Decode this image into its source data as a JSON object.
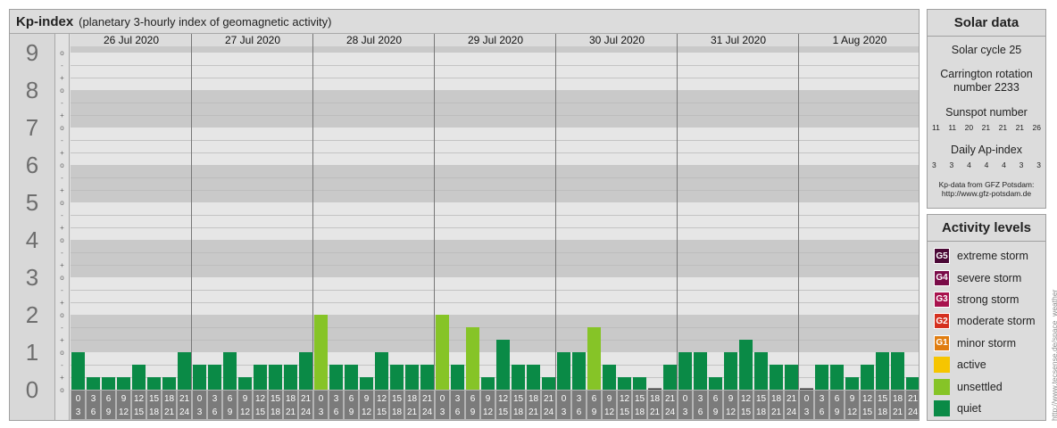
{
  "header": {
    "title": "Kp-index",
    "subtitle": "(planetary 3-hourly index of geomagnetic activity)"
  },
  "chart_data": {
    "type": "bar",
    "title": "Kp-index",
    "subtitle": "(planetary 3-hourly index of geomagnetic activity)",
    "y_axis_labels": [
      "0",
      "1",
      "2",
      "3",
      "4",
      "5",
      "6",
      "7",
      "8",
      "9"
    ],
    "sub_ticks": [
      "o",
      "+",
      "-"
    ],
    "ylim": [
      0,
      9.333
    ],
    "days": [
      "26 Jul 2020",
      "27 Jul 2020",
      "28 Jul 2020",
      "29 Jul 2020",
      "30 Jul 2020",
      "31 Jul 2020",
      "1 Aug 2020"
    ],
    "interval_start_labels": [
      "0",
      "3",
      "6",
      "9",
      "12",
      "15",
      "18",
      "21"
    ],
    "interval_end_labels": [
      "3",
      "6",
      "9",
      "12",
      "15",
      "18",
      "21",
      "24"
    ],
    "values": [
      [
        1.0,
        0.333,
        0.333,
        0.333,
        0.667,
        0.333,
        0.333,
        1.0
      ],
      [
        0.667,
        0.667,
        1.0,
        0.333,
        0.667,
        0.667,
        0.667,
        1.0
      ],
      [
        2.0,
        0.667,
        0.667,
        0.333,
        1.0,
        0.667,
        0.667,
        0.667
      ],
      [
        2.0,
        0.667,
        1.667,
        0.333,
        1.333,
        0.667,
        0.667,
        0.333
      ],
      [
        1.0,
        1.0,
        1.667,
        0.667,
        0.333,
        0.333,
        0.0,
        0.667
      ],
      [
        1.0,
        1.0,
        0.333,
        1.0,
        1.333,
        1.0,
        0.667,
        0.667
      ],
      [
        0.0,
        0.667,
        0.667,
        0.333,
        0.667,
        1.0,
        1.0,
        0.333
      ]
    ],
    "colors": {
      "quiet": "#0a8a46",
      "unsettled": "#86c427",
      "active": "#f6c500",
      "minor_storm": "#e07d10",
      "moderate_storm": "#d5301f",
      "strong_storm": "#a8124d",
      "severe_storm": "#7a0c48",
      "extreme_storm": "#4b0836"
    }
  },
  "solar_data": {
    "heading": "Solar data",
    "solar_cycle": "Solar cycle 25",
    "carrington_line1": "Carrington rotation",
    "carrington_line2": "number 2233",
    "sunspot_label": "Sunspot number",
    "sunspot_values": [
      "11",
      "11",
      "20",
      "21",
      "21",
      "21",
      "26"
    ],
    "ap_label": "Daily Ap-index",
    "ap_values": [
      "3",
      "3",
      "4",
      "4",
      "4",
      "3",
      "3"
    ],
    "source_line1": "Kp-data from GFZ Potsdam:",
    "source_line2": "http://www.gfz-potsdam.de"
  },
  "activity_levels": {
    "heading": "Activity levels",
    "items": [
      {
        "badge": "G5",
        "label": "extreme storm",
        "color": "#4b0836",
        "icon": "g5-badge-icon"
      },
      {
        "badge": "G4",
        "label": "severe storm",
        "color": "#7a0c48",
        "icon": "g4-badge-icon"
      },
      {
        "badge": "G3",
        "label": "strong storm",
        "color": "#a8124d",
        "icon": "g3-badge-icon"
      },
      {
        "badge": "G2",
        "label": "moderate storm",
        "color": "#d5301f",
        "icon": "g2-badge-icon"
      },
      {
        "badge": "G1",
        "label": "minor storm",
        "color": "#e07d10",
        "icon": "g1-badge-icon"
      },
      {
        "badge": "",
        "label": "active",
        "color": "#f6c500",
        "icon": "active-swatch-icon"
      },
      {
        "badge": "",
        "label": "unsettled",
        "color": "#86c427",
        "icon": "unsettled-swatch-icon"
      },
      {
        "badge": "",
        "label": "quiet",
        "color": "#0a8a46",
        "icon": "quiet-swatch-icon"
      }
    ]
  },
  "watermark": "http://www.tecsense.de/space_weather"
}
